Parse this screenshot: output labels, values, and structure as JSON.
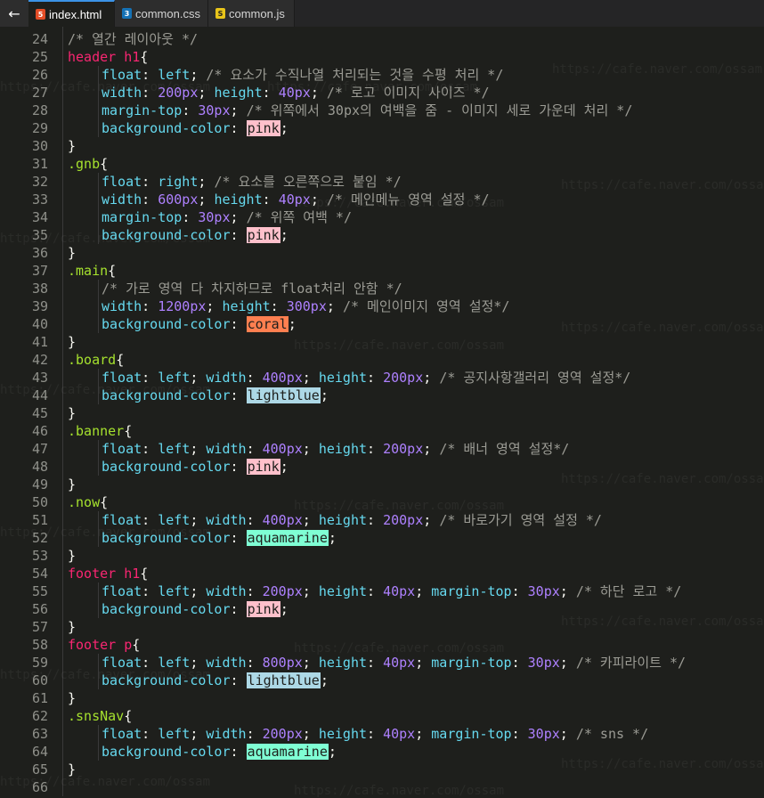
{
  "tabs": [
    {
      "label": "index.html",
      "icon": "html-file-icon",
      "active": true
    },
    {
      "label": "common.css",
      "icon": "css-file-icon",
      "active": false
    },
    {
      "label": "common.js",
      "icon": "js-file-icon",
      "active": false
    }
  ],
  "back_glyph": "←",
  "colors": {
    "pink": "#ffc0cb",
    "coral": "#ff7f50",
    "lightblue": "#add8e6",
    "aquamarine": "#7fffd4"
  },
  "watermark": "https://cafe.naver.com/ossam",
  "lines": [
    {
      "n": "24",
      "ind": 0,
      "tokens": [
        [
          "cmt",
          "/* 열간 레이아웃 */"
        ]
      ]
    },
    {
      "n": "25",
      "ind": 0,
      "tokens": [
        [
          "sel",
          "header h1"
        ],
        [
          "pun",
          "{"
        ]
      ]
    },
    {
      "n": "26",
      "ind": 1,
      "tokens": [
        [
          "prop",
          "float"
        ],
        [
          "pun",
          ": "
        ],
        [
          "kw",
          "left"
        ],
        [
          "pun",
          "; "
        ],
        [
          "cmt",
          "/* 요소가 수직나열 처리되는 것을 수평 처리 */"
        ]
      ]
    },
    {
      "n": "27",
      "ind": 1,
      "tokens": [
        [
          "prop",
          "width"
        ],
        [
          "pun",
          ": "
        ],
        [
          "num",
          "200px"
        ],
        [
          "pun",
          "; "
        ],
        [
          "prop",
          "height"
        ],
        [
          "pun",
          ": "
        ],
        [
          "num",
          "40px"
        ],
        [
          "pun",
          "; "
        ],
        [
          "cmt",
          "/* 로고 이미지 사이즈 */"
        ]
      ]
    },
    {
      "n": "28",
      "ind": 1,
      "tokens": [
        [
          "prop",
          "margin-top"
        ],
        [
          "pun",
          ": "
        ],
        [
          "num",
          "30px"
        ],
        [
          "pun",
          "; "
        ],
        [
          "cmt",
          "/* 위쪽에서 30px의 여백을 줌 - 이미지 세로 가운데 처리 */"
        ]
      ]
    },
    {
      "n": "29",
      "ind": 1,
      "tokens": [
        [
          "prop",
          "background-color"
        ],
        [
          "pun",
          ": "
        ],
        [
          "sw-pink",
          "pink"
        ],
        [
          "pun",
          ";"
        ]
      ]
    },
    {
      "n": "30",
      "ind": 0,
      "tokens": [
        [
          "pun",
          "}"
        ]
      ]
    },
    {
      "n": "31",
      "ind": 0,
      "tokens": [
        [
          "cls",
          ".gnb"
        ],
        [
          "pun",
          "{"
        ]
      ]
    },
    {
      "n": "32",
      "ind": 1,
      "tokens": [
        [
          "prop",
          "float"
        ],
        [
          "pun",
          ": "
        ],
        [
          "kw",
          "right"
        ],
        [
          "pun",
          "; "
        ],
        [
          "cmt",
          "/* 요소를 오른쪽으로 붙임 */"
        ]
      ]
    },
    {
      "n": "33",
      "ind": 1,
      "tokens": [
        [
          "prop",
          "width"
        ],
        [
          "pun",
          ": "
        ],
        [
          "num",
          "600px"
        ],
        [
          "pun",
          "; "
        ],
        [
          "prop",
          "height"
        ],
        [
          "pun",
          ": "
        ],
        [
          "num",
          "40px"
        ],
        [
          "pun",
          "; "
        ],
        [
          "cmt",
          "/* 메인메뉴 영역 설정 */"
        ]
      ]
    },
    {
      "n": "34",
      "ind": 1,
      "tokens": [
        [
          "prop",
          "margin-top"
        ],
        [
          "pun",
          ": "
        ],
        [
          "num",
          "30px"
        ],
        [
          "pun",
          "; "
        ],
        [
          "cmt",
          "/* 위쪽 여백 */"
        ]
      ]
    },
    {
      "n": "35",
      "ind": 1,
      "tokens": [
        [
          "prop",
          "background-color"
        ],
        [
          "pun",
          ": "
        ],
        [
          "sw-pink",
          "pink"
        ],
        [
          "pun",
          ";"
        ]
      ]
    },
    {
      "n": "36",
      "ind": 0,
      "tokens": [
        [
          "pun",
          "}"
        ]
      ]
    },
    {
      "n": "37",
      "ind": 0,
      "tokens": [
        [
          "cls",
          ".main"
        ],
        [
          "pun",
          "{"
        ]
      ]
    },
    {
      "n": "38",
      "ind": 1,
      "tokens": [
        [
          "cmt",
          "/* 가로 영역 다 차지하므로 float처리 안함 */"
        ]
      ]
    },
    {
      "n": "39",
      "ind": 1,
      "tokens": [
        [
          "prop",
          "width"
        ],
        [
          "pun",
          ": "
        ],
        [
          "num",
          "1200px"
        ],
        [
          "pun",
          "; "
        ],
        [
          "prop",
          "height"
        ],
        [
          "pun",
          ": "
        ],
        [
          "num",
          "300px"
        ],
        [
          "pun",
          "; "
        ],
        [
          "cmt",
          "/* 메인이미지 영역 설정*/"
        ]
      ]
    },
    {
      "n": "40",
      "ind": 1,
      "tokens": [
        [
          "prop",
          "background-color"
        ],
        [
          "pun",
          ": "
        ],
        [
          "sw-coral",
          "coral"
        ],
        [
          "pun",
          ";"
        ]
      ]
    },
    {
      "n": "41",
      "ind": 0,
      "tokens": [
        [
          "pun",
          "}"
        ]
      ]
    },
    {
      "n": "42",
      "ind": 0,
      "tokens": [
        [
          "cls",
          ".board"
        ],
        [
          "pun",
          "{"
        ]
      ]
    },
    {
      "n": "43",
      "ind": 1,
      "tokens": [
        [
          "prop",
          "float"
        ],
        [
          "pun",
          ": "
        ],
        [
          "kw",
          "left"
        ],
        [
          "pun",
          "; "
        ],
        [
          "prop",
          "width"
        ],
        [
          "pun",
          ": "
        ],
        [
          "num",
          "400px"
        ],
        [
          "pun",
          "; "
        ],
        [
          "prop",
          "height"
        ],
        [
          "pun",
          ": "
        ],
        [
          "num",
          "200px"
        ],
        [
          "pun",
          "; "
        ],
        [
          "cmt",
          "/* 공지사항갤러리 영역 설정*/"
        ]
      ]
    },
    {
      "n": "44",
      "ind": 1,
      "tokens": [
        [
          "prop",
          "background-color"
        ],
        [
          "pun",
          ": "
        ],
        [
          "sw-lightblue",
          "lightblue"
        ],
        [
          "pun",
          ";"
        ]
      ]
    },
    {
      "n": "45",
      "ind": 0,
      "tokens": [
        [
          "pun",
          "}"
        ]
      ]
    },
    {
      "n": "46",
      "ind": 0,
      "tokens": [
        [
          "cls",
          ".banner"
        ],
        [
          "pun",
          "{"
        ]
      ]
    },
    {
      "n": "47",
      "ind": 1,
      "tokens": [
        [
          "prop",
          "float"
        ],
        [
          "pun",
          ": "
        ],
        [
          "kw",
          "left"
        ],
        [
          "pun",
          "; "
        ],
        [
          "prop",
          "width"
        ],
        [
          "pun",
          ": "
        ],
        [
          "num",
          "400px"
        ],
        [
          "pun",
          "; "
        ],
        [
          "prop",
          "height"
        ],
        [
          "pun",
          ": "
        ],
        [
          "num",
          "200px"
        ],
        [
          "pun",
          "; "
        ],
        [
          "cmt",
          "/* 배너 영역 설정*/"
        ]
      ]
    },
    {
      "n": "48",
      "ind": 1,
      "tokens": [
        [
          "prop",
          "background-color"
        ],
        [
          "pun",
          ": "
        ],
        [
          "sw-pink",
          "pink"
        ],
        [
          "pun",
          ";"
        ]
      ]
    },
    {
      "n": "49",
      "ind": 0,
      "tokens": [
        [
          "pun",
          "}"
        ]
      ]
    },
    {
      "n": "50",
      "ind": 0,
      "tokens": [
        [
          "cls",
          ".now"
        ],
        [
          "pun",
          "{"
        ]
      ]
    },
    {
      "n": "51",
      "ind": 1,
      "tokens": [
        [
          "prop",
          "float"
        ],
        [
          "pun",
          ": "
        ],
        [
          "kw",
          "left"
        ],
        [
          "pun",
          "; "
        ],
        [
          "prop",
          "width"
        ],
        [
          "pun",
          ": "
        ],
        [
          "num",
          "400px"
        ],
        [
          "pun",
          "; "
        ],
        [
          "prop",
          "height"
        ],
        [
          "pun",
          ": "
        ],
        [
          "num",
          "200px"
        ],
        [
          "pun",
          "; "
        ],
        [
          "cmt",
          "/* 바로가기 영역 설정 */"
        ]
      ]
    },
    {
      "n": "52",
      "ind": 1,
      "tokens": [
        [
          "prop",
          "background-color"
        ],
        [
          "pun",
          ": "
        ],
        [
          "sw-aquamarine",
          "aquamarine"
        ],
        [
          "pun",
          ";"
        ]
      ]
    },
    {
      "n": "53",
      "ind": 0,
      "tokens": [
        [
          "pun",
          "}"
        ]
      ]
    },
    {
      "n": "54",
      "ind": 0,
      "tokens": [
        [
          "sel",
          "footer h1"
        ],
        [
          "pun",
          "{"
        ]
      ]
    },
    {
      "n": "55",
      "ind": 1,
      "tokens": [
        [
          "prop",
          "float"
        ],
        [
          "pun",
          ": "
        ],
        [
          "kw",
          "left"
        ],
        [
          "pun",
          "; "
        ],
        [
          "prop",
          "width"
        ],
        [
          "pun",
          ": "
        ],
        [
          "num",
          "200px"
        ],
        [
          "pun",
          "; "
        ],
        [
          "prop",
          "height"
        ],
        [
          "pun",
          ": "
        ],
        [
          "num",
          "40px"
        ],
        [
          "pun",
          "; "
        ],
        [
          "prop",
          "margin-top"
        ],
        [
          "pun",
          ": "
        ],
        [
          "num",
          "30px"
        ],
        [
          "pun",
          "; "
        ],
        [
          "cmt",
          "/* 하단 로고 */"
        ]
      ]
    },
    {
      "n": "56",
      "ind": 1,
      "tokens": [
        [
          "prop",
          "background-color"
        ],
        [
          "pun",
          ": "
        ],
        [
          "sw-pink",
          "pink"
        ],
        [
          "pun",
          ";"
        ]
      ]
    },
    {
      "n": "57",
      "ind": 0,
      "tokens": [
        [
          "pun",
          "}"
        ]
      ]
    },
    {
      "n": "58",
      "ind": 0,
      "tokens": [
        [
          "sel",
          "footer p"
        ],
        [
          "pun",
          "{"
        ]
      ]
    },
    {
      "n": "59",
      "ind": 1,
      "tokens": [
        [
          "prop",
          "float"
        ],
        [
          "pun",
          ": "
        ],
        [
          "kw",
          "left"
        ],
        [
          "pun",
          "; "
        ],
        [
          "prop",
          "width"
        ],
        [
          "pun",
          ": "
        ],
        [
          "num",
          "800px"
        ],
        [
          "pun",
          "; "
        ],
        [
          "prop",
          "height"
        ],
        [
          "pun",
          ": "
        ],
        [
          "num",
          "40px"
        ],
        [
          "pun",
          "; "
        ],
        [
          "prop",
          "margin-top"
        ],
        [
          "pun",
          ": "
        ],
        [
          "num",
          "30px"
        ],
        [
          "pun",
          "; "
        ],
        [
          "cmt",
          "/* 카피라이트 */"
        ]
      ]
    },
    {
      "n": "60",
      "ind": 1,
      "tokens": [
        [
          "prop",
          "background-color"
        ],
        [
          "pun",
          ": "
        ],
        [
          "sw-lightblue",
          "lightblue"
        ],
        [
          "pun",
          ";"
        ]
      ]
    },
    {
      "n": "61",
      "ind": 0,
      "tokens": [
        [
          "pun",
          "}"
        ]
      ]
    },
    {
      "n": "62",
      "ind": 0,
      "tokens": [
        [
          "cls",
          ".snsNav"
        ],
        [
          "pun",
          "{"
        ]
      ]
    },
    {
      "n": "63",
      "ind": 1,
      "tokens": [
        [
          "prop",
          "float"
        ],
        [
          "pun",
          ": "
        ],
        [
          "kw",
          "left"
        ],
        [
          "pun",
          "; "
        ],
        [
          "prop",
          "width"
        ],
        [
          "pun",
          ": "
        ],
        [
          "num",
          "200px"
        ],
        [
          "pun",
          "; "
        ],
        [
          "prop",
          "height"
        ],
        [
          "pun",
          ": "
        ],
        [
          "num",
          "40px"
        ],
        [
          "pun",
          "; "
        ],
        [
          "prop",
          "margin-top"
        ],
        [
          "pun",
          ": "
        ],
        [
          "num",
          "30px"
        ],
        [
          "pun",
          "; "
        ],
        [
          "cmt",
          "/* sns */"
        ]
      ]
    },
    {
      "n": "64",
      "ind": 1,
      "tokens": [
        [
          "prop",
          "background-color"
        ],
        [
          "pun",
          ": "
        ],
        [
          "sw-aquamarine",
          "aquamarine"
        ],
        [
          "pun",
          ";"
        ]
      ]
    },
    {
      "n": "65",
      "ind": 0,
      "tokens": [
        [
          "pun",
          "}"
        ]
      ]
    },
    {
      "n": "66",
      "ind": 0,
      "tokens": []
    }
  ]
}
